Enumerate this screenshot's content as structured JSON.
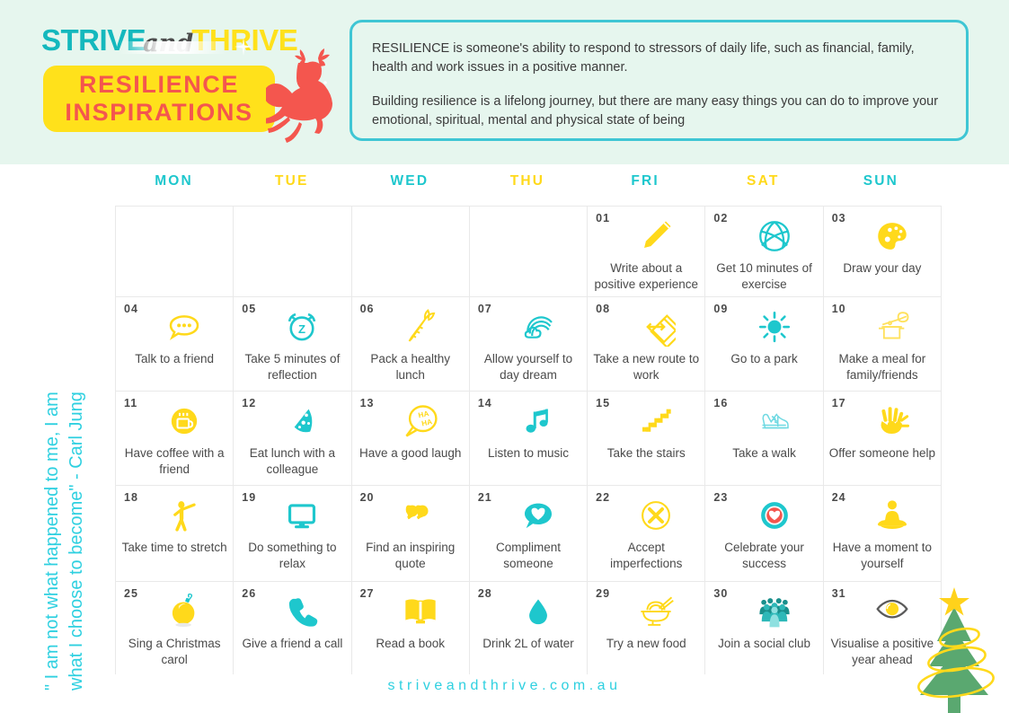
{
  "brand": {
    "logo_part1": "STRIVE",
    "logo_part2": "and",
    "logo_part3": "THRIVE",
    "title_line1": "RESILIENCE",
    "title_line2": "INSPIRATIONS",
    "teal": "#14b8bd",
    "yellow": "#ffe11b",
    "coral": "#f4564e",
    "band_bg": "#e6f6ee"
  },
  "description": {
    "paragraph1": "RESILIENCE is someone's ability to respond to stressors of daily life, such as financial, family, health and work issues in a positive manner.",
    "paragraph2": "Building resilience is a lifelong journey, but there are many easy things you can do to improve your emotional, spiritual, mental and physical state of being"
  },
  "quote": {
    "line1": "\" I am not what happened to me, I am",
    "line2": "what I choose to become\" - Carl Jung"
  },
  "calendar": {
    "daynames": [
      {
        "label": "MON",
        "color": "teal"
      },
      {
        "label": "TUE",
        "color": "yellow"
      },
      {
        "label": "WED",
        "color": "teal"
      },
      {
        "label": "THU",
        "color": "yellow"
      },
      {
        "label": "FRI",
        "color": "teal"
      },
      {
        "label": "SAT",
        "color": "yellow"
      },
      {
        "label": "SUN",
        "color": "teal"
      }
    ],
    "cells": [
      {
        "day": "",
        "label": "",
        "icon": ""
      },
      {
        "day": "",
        "label": "",
        "icon": ""
      },
      {
        "day": "",
        "label": "",
        "icon": ""
      },
      {
        "day": "",
        "label": "",
        "icon": ""
      },
      {
        "day": "01",
        "label": "Write about a positive experience",
        "icon": "pencil-icon"
      },
      {
        "day": "02",
        "label": "Get 10 minutes of exercise",
        "icon": "volleyball-icon"
      },
      {
        "day": "03",
        "label": "Draw your day",
        "icon": "palette-icon"
      },
      {
        "day": "04",
        "label": "Talk to a friend",
        "icon": "speech-bubble-icon"
      },
      {
        "day": "05",
        "label": "Take 5 minutes of reflection",
        "icon": "alarm-clock-icon"
      },
      {
        "day": "06",
        "label": "Pack a healthy lunch",
        "icon": "carrot-icon"
      },
      {
        "day": "07",
        "label": "Allow yourself to day dream",
        "icon": "rainbow-cloud-icon"
      },
      {
        "day": "08",
        "label": "Take a new route to work",
        "icon": "road-sign-icon"
      },
      {
        "day": "09",
        "label": "Go to a park",
        "icon": "sun-icon"
      },
      {
        "day": "10",
        "label": "Make a meal for family/friends",
        "icon": "cooking-pot-icon"
      },
      {
        "day": "11",
        "label": "Have coffee with a friend",
        "icon": "coffee-cup-icon"
      },
      {
        "day": "12",
        "label": "Eat lunch with a colleague",
        "icon": "pizza-slice-icon"
      },
      {
        "day": "13",
        "label": "Have a good laugh",
        "icon": "laugh-bubble-icon"
      },
      {
        "day": "14",
        "label": "Listen to music",
        "icon": "music-note-icon"
      },
      {
        "day": "15",
        "label": "Take the stairs",
        "icon": "stairs-icon"
      },
      {
        "day": "16",
        "label": "Take a walk",
        "icon": "sneaker-icon"
      },
      {
        "day": "17",
        "label": "Offer someone help",
        "icon": "helping-hand-icon"
      },
      {
        "day": "18",
        "label": "Take time to stretch",
        "icon": "stretching-person-icon"
      },
      {
        "day": "19",
        "label": "Do something to relax",
        "icon": "monitor-icon"
      },
      {
        "day": "20",
        "label": "Find an inspiring quote",
        "icon": "quotation-marks-icon"
      },
      {
        "day": "21",
        "label": "Compliment someone",
        "icon": "heart-speech-bubble-icon"
      },
      {
        "day": "22",
        "label": "Accept imperfections",
        "icon": "cross-circle-icon"
      },
      {
        "day": "23",
        "label": "Celebrate your success",
        "icon": "heart-target-icon"
      },
      {
        "day": "24",
        "label": "Have a moment to yourself",
        "icon": "meditation-icon"
      },
      {
        "day": "25",
        "label": "Sing a Christmas carol",
        "icon": "bauble-icon"
      },
      {
        "day": "26",
        "label": "Give a friend a call",
        "icon": "phone-icon"
      },
      {
        "day": "27",
        "label": "Read a book",
        "icon": "open-book-icon"
      },
      {
        "day": "28",
        "label": "Drink 2L of water",
        "icon": "water-drop-icon"
      },
      {
        "day": "29",
        "label": "Try a new food",
        "icon": "noodle-bowl-icon"
      },
      {
        "day": "30",
        "label": "Join a social club",
        "icon": "people-group-icon"
      },
      {
        "day": "31",
        "label": "Visualise a positive year ahead",
        "icon": "eye-icon"
      }
    ]
  },
  "footer": {
    "website": "striveandthrive.com.au"
  },
  "decorations": {
    "deer": "reindeer-icon",
    "tree": "christmas-tree-icon"
  }
}
